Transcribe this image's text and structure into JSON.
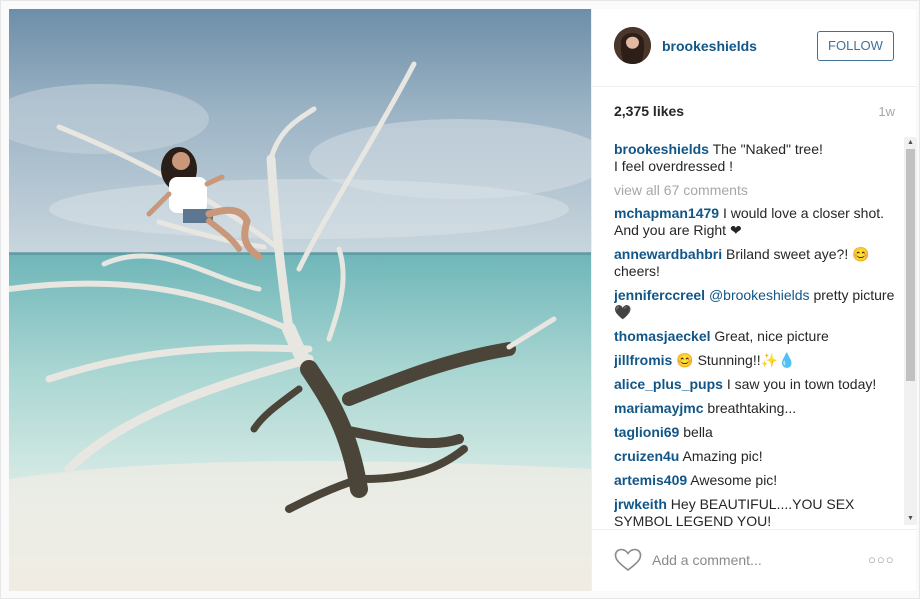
{
  "post": {
    "username": "brookeshields",
    "follow_label": "FOLLOW",
    "likes": "2,375 likes",
    "age": "1w",
    "caption_line1": "The \"Naked\" tree!",
    "caption_line2": "I feel overdressed !",
    "view_all": "view all 67 comments"
  },
  "comments": [
    {
      "user": "mchapman1479",
      "text": "I would love a closer shot. And you are Right ❤"
    },
    {
      "user": "annewardbahbri",
      "text": "Briland sweet aye?! 😊 cheers!"
    },
    {
      "user": "jenniferccreel",
      "mention": "@brookeshields",
      "text": "pretty picture 🖤"
    },
    {
      "user": "thomasjaeckel",
      "text": "Great, nice picture"
    },
    {
      "user": "jillfromis",
      "text": "😊 Stunning!!✨💧"
    },
    {
      "user": "alice_plus_pups",
      "text": "I saw you in town today!"
    },
    {
      "user": "mariamayjmc",
      "text": "breathtaking..."
    },
    {
      "user": "taglioni69",
      "text": "bella"
    },
    {
      "user": "cruizen4u",
      "text": "Amazing pic!"
    },
    {
      "user": "artemis409",
      "text": "Awesome pic!"
    },
    {
      "user": "jrwkeith",
      "text": "Hey BEAUTIFUL....YOU SEX SYMBOL LEGEND YOU!"
    }
  ],
  "footer": {
    "add_comment_placeholder": "Add a comment...",
    "more_label": "○○○"
  },
  "colors": {
    "accent": "#125688",
    "follow_border": "#3f729b",
    "muted": "#a5a7aa"
  },
  "icons": [
    "heart-icon",
    "more-options-icon",
    "scroll-up-icon",
    "scroll-down-icon"
  ]
}
